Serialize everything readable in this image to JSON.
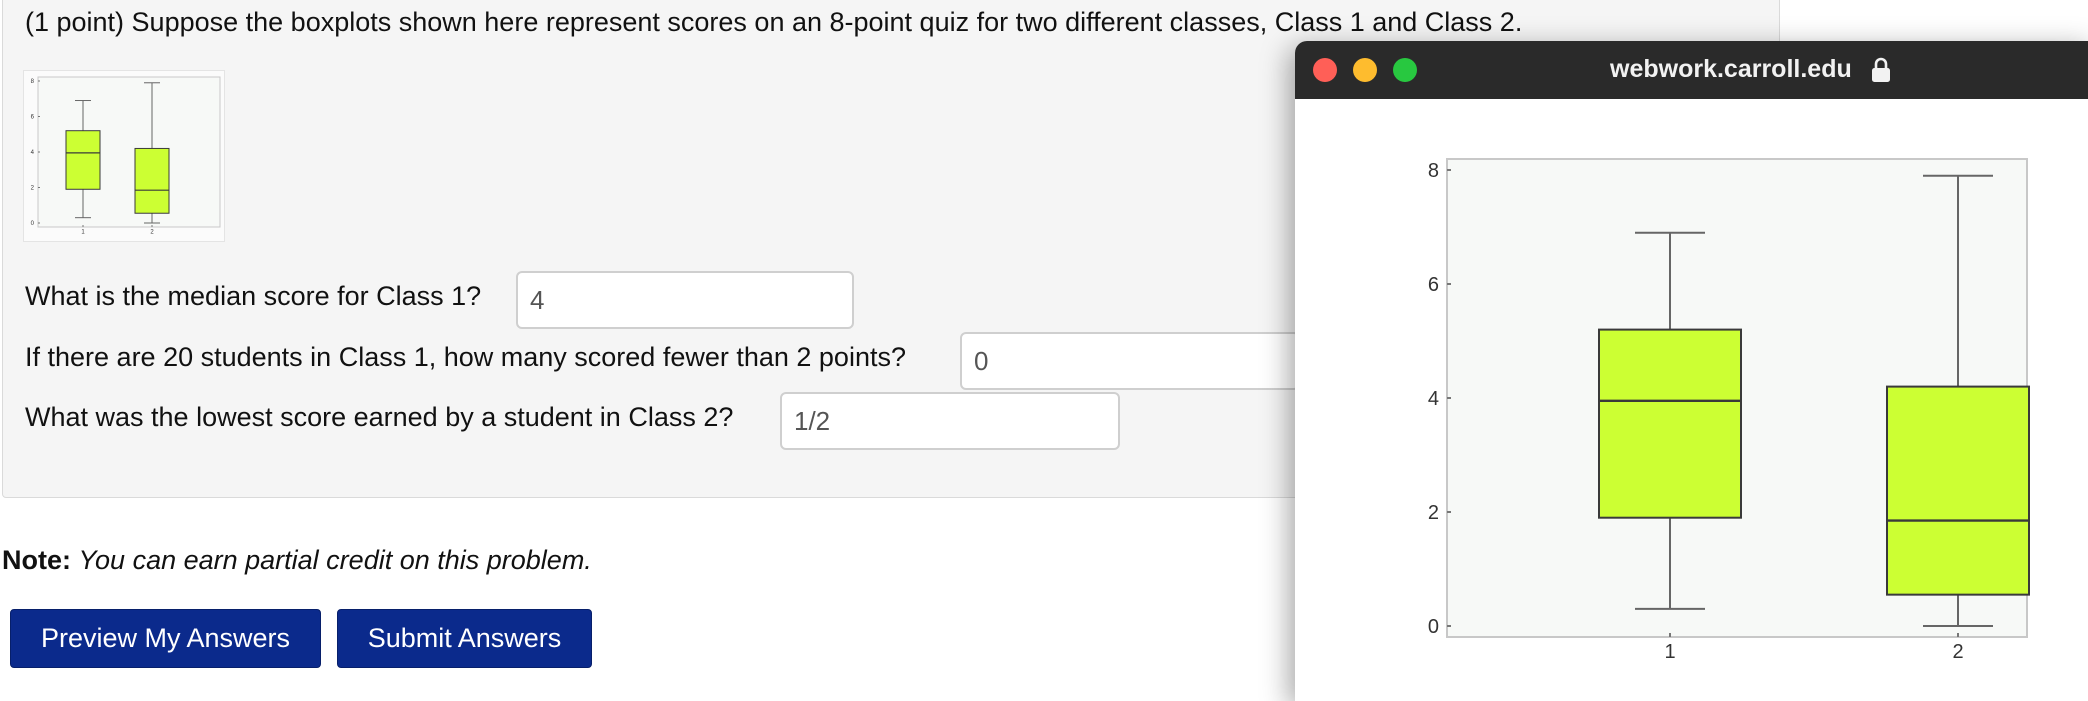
{
  "problem": {
    "prompt": "(1 point) Suppose the boxplots shown here represent scores on an 8-point quiz for two different classes, Class 1 and Class 2.",
    "questions": [
      {
        "label": "What is the median score for Class 1?",
        "answer": "4"
      },
      {
        "label": "If there are 20 students in Class 1, how many scored fewer than 2 points?",
        "answer": "0"
      },
      {
        "label": "What was the lowest score earned by a student in Class 2?",
        "answer": "1/2"
      }
    ]
  },
  "note": {
    "bold": "Note:",
    "text": "You can earn partial credit on this problem."
  },
  "buttons": {
    "preview": "Preview My Answers",
    "submit": "Submit Answers"
  },
  "popup": {
    "url": "webwork.carroll.edu",
    "icons": [
      "close-icon",
      "minimize-icon",
      "zoom-icon",
      "lock-icon"
    ]
  },
  "chart_data": {
    "type": "boxplot",
    "categories": [
      "1",
      "2"
    ],
    "yticks": [
      0,
      2,
      4,
      6,
      8
    ],
    "ylim": [
      0,
      8
    ],
    "box_color": "#ccff33",
    "boxes": [
      {
        "category": "1",
        "min": 0.3,
        "q1": 1.9,
        "median": 3.95,
        "q3": 5.2,
        "max": 6.9
      },
      {
        "category": "2",
        "min": 0.0,
        "q1": 0.55,
        "median": 1.85,
        "q3": 4.2,
        "max": 7.9
      }
    ]
  }
}
